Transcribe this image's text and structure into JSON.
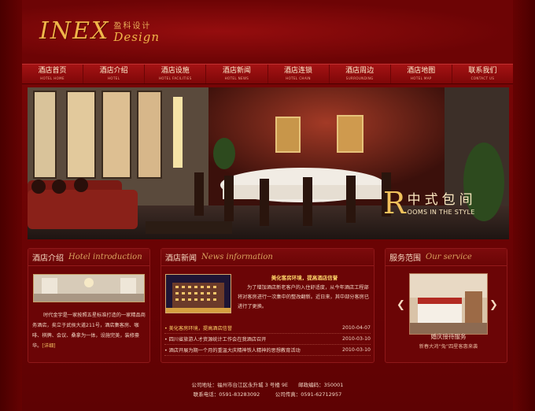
{
  "logo": {
    "main": "INEX",
    "cn": "盈科设计",
    "sub": "Design"
  },
  "nav": [
    {
      "cn": "酒店首页",
      "en": "HOTEL HOME"
    },
    {
      "cn": "酒店介绍",
      "en": "HOTEL"
    },
    {
      "cn": "酒店设施",
      "en": "HOTEL FACILITIES"
    },
    {
      "cn": "酒店新闻",
      "en": "HOTEL NEWS"
    },
    {
      "cn": "酒店连锁",
      "en": "HOTEL CHAIN"
    },
    {
      "cn": "酒店周边",
      "en": "SURROUNDING"
    },
    {
      "cn": "酒店地图",
      "en": "HOTEL MAP"
    },
    {
      "cn": "联系我们",
      "en": "CONTACT US"
    }
  ],
  "hero": {
    "big_letter": "R",
    "cn": "中式包间",
    "en": "OOMS IN THE STYLE"
  },
  "intro": {
    "cn": "酒店介绍",
    "en": "Hotel introduction",
    "text": "时代金宇是一家按照五星标准打造的一家精品商务酒店，矣立于武侯大道211号，酒店集客房、咖啡、棋牌、会议、桑拿为一体，设施完美，装修豪华。",
    "more": "[详细]"
  },
  "news": {
    "cn": "酒店新闻",
    "en": "News information",
    "headline": "美化客房环境，提高酒店信誉",
    "body": "为了增加酒店新老客户的入住舒适度，从今年酒店工程部将对客房进行一次集中的整改翻新。近日来，其中部分客房已进行了更换。",
    "items": [
      {
        "title": "美化客房环境，提高酒店信誉",
        "date": "2010-04-07"
      },
      {
        "title": "四川省旅游人才资源统计工作会在我酒店召开",
        "date": "2010-03-10"
      },
      {
        "title": "酒店开展为期一个月的重温大庆精神铁人精神的思想教育活动",
        "date": "2010-03-10"
      }
    ]
  },
  "service": {
    "cn": "服务范围",
    "en": "Our service",
    "title": "婚庆接待服务",
    "sub": "新春大鸿“兔”四星客惠来袭"
  },
  "footer": {
    "line1": "公司地址：福州市台江区永升城 3 号楼 9E　　邮政编码：350001",
    "line2": "联系电话：0591-83283092　　　公司传真：0591-62712957"
  }
}
